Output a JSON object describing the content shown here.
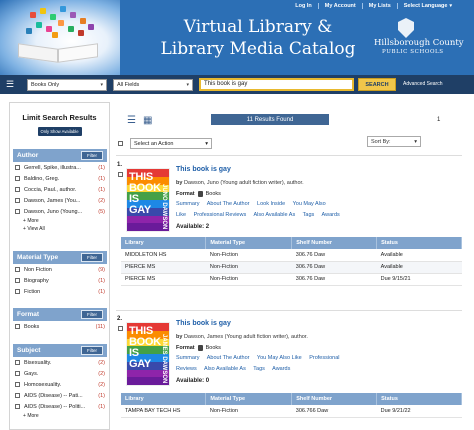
{
  "header": {
    "title_line1": "Virtual Library &",
    "title_line2": "Library Media Catalog",
    "district_name": "Hillsborough County",
    "district_sub": "PUBLIC SCHOOLS",
    "top_links": [
      {
        "label": "Log In",
        "icon": "login-icon"
      },
      {
        "label": "My Account",
        "icon": "account-icon"
      },
      {
        "label": "My Lists",
        "icon": "list-icon"
      },
      {
        "label": "Select Language",
        "icon": "chevron-down-icon"
      }
    ]
  },
  "search": {
    "scope": "Books Only",
    "field": "All Fields",
    "query": "This book is gay",
    "button": "SEARCH",
    "advanced": "Advanced Search"
  },
  "sidebar": {
    "title": "Limit Search Results",
    "only_available": "Only Show Available",
    "filter_label": "Filter",
    "more": "More",
    "view_all": "View All",
    "author": {
      "heading": "Author",
      "items": [
        {
          "label": "Gerrell, Spike, illustra...",
          "count": "(1)"
        },
        {
          "label": "Baldino, Greg.",
          "count": "(1)"
        },
        {
          "label": "Coccia, Paul., author.",
          "count": "(1)"
        },
        {
          "label": "Dawson, James (You...",
          "count": "(2)"
        },
        {
          "label": "Dawson, Juno (Young...",
          "count": "(5)"
        }
      ]
    },
    "material": {
      "heading": "Material Type",
      "items": [
        {
          "label": "Non Fiction",
          "count": "(9)"
        },
        {
          "label": "Biography",
          "count": "(1)"
        },
        {
          "label": "Fiction",
          "count": "(1)"
        }
      ]
    },
    "format": {
      "heading": "Format",
      "items": [
        {
          "label": "Books",
          "count": "(11)"
        }
      ]
    },
    "subject": {
      "heading": "Subject",
      "items": [
        {
          "label": "Bisexuality.",
          "count": "(2)"
        },
        {
          "label": "Gays.",
          "count": "(2)"
        },
        {
          "label": "Homosexuality.",
          "count": "(2)"
        },
        {
          "label": "AIDS (Disease) -- Pati...",
          "count": "(1)"
        },
        {
          "label": "AIDS (Disease) -- Politi...",
          "count": "(1)"
        }
      ]
    }
  },
  "toolbar": {
    "results_count": "11 Results Found",
    "page": "1",
    "select_action": "Select an Action",
    "sort_by": "Sort By:"
  },
  "results": [
    {
      "num": "1.",
      "title": "This book is gay",
      "by_label": "by",
      "author": "Dawson, Juno (Young adult fiction writer), author.",
      "format_label": "Format",
      "format_value": "Books",
      "links_line1": [
        "Summary",
        "About The Author",
        "Look Inside",
        "You May Also"
      ],
      "links_line2": [
        "Like",
        "Professional Reviews",
        "Also Available As",
        "Tags",
        "Awards"
      ],
      "available_label": "Available:",
      "available_count": "2",
      "cover_title": "THIS BOOK IS GAY",
      "cover_author": "JUNO DAWSON",
      "holdings": [
        {
          "library": "MIDDLETON HS",
          "material": "Non-Fiction",
          "shelf": "306.76 Daw",
          "status": "Available"
        },
        {
          "library": "PIERCE MS",
          "material": "Non-Fiction",
          "shelf": "306.76 Daw",
          "status": "Available"
        },
        {
          "library": "PIERCE MS",
          "material": "Non-Fiction",
          "shelf": "306.76 Daw",
          "status": "Due 9/15/21"
        }
      ]
    },
    {
      "num": "2.",
      "title": "This book is gay",
      "by_label": "by",
      "author": "Dawson, James (Young adult fiction writer), author.",
      "format_label": "Format",
      "format_value": "Books",
      "links_line1": [
        "Summary",
        "About The Author",
        "You May Also Like",
        "Professional"
      ],
      "links_line2": [
        "Reviews",
        "Also Available As",
        "Tags",
        "Awards"
      ],
      "available_label": "Available:",
      "available_count": "0",
      "cover_title": "THIS BOOK IS GAY",
      "cover_author": "JAMES DAWSON",
      "holdings": [
        {
          "library": "TAMPA BAY TECH HS",
          "material": "Non-Fiction",
          "shelf": "306.766 Daw",
          "status": "Due 9/21/22"
        }
      ]
    }
  ],
  "table_headers": {
    "library": "Library",
    "material": "Material Type",
    "shelf": "Shelf Number",
    "status": "Status"
  },
  "colors": {
    "banner": "#2c6fb5",
    "search_bar": "#1f3f66",
    "facet_header": "#7fa3cc",
    "link": "#1f5fa8",
    "search_button": "#f0c64a"
  }
}
